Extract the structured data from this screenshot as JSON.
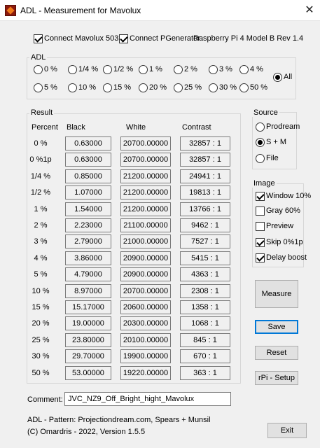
{
  "window": {
    "title": "ADL - Measurement for Mavolux"
  },
  "connections": {
    "mavolux": {
      "label": "Connect Mavolux 5032",
      "checked": true
    },
    "pgenerator": {
      "label": "Connect PGenerator",
      "checked": true
    },
    "device_info": "Raspberry Pi 4 Model B Rev 1.4"
  },
  "adl": {
    "title": "ADL",
    "row1": [
      "0 %",
      "1/4 %",
      "1/2 %",
      "1 %",
      "2 %",
      "3 %",
      "4 %"
    ],
    "row2": [
      "5 %",
      "10 %",
      "15 %",
      "20 %",
      "25 %",
      "30 %",
      "50 %"
    ],
    "all_label": "All",
    "selected": "All"
  },
  "result": {
    "title": "Result",
    "headers": {
      "percent": "Percent",
      "black": "Black",
      "white": "White",
      "contrast": "Contrast"
    },
    "rows": [
      {
        "percent": "0 %",
        "black": "0.63000",
        "white": "20700.00000",
        "contrast": "32857 : 1"
      },
      {
        "percent": "0 %1p",
        "black": "0.63000",
        "white": "20700.00000",
        "contrast": "32857 : 1"
      },
      {
        "percent": "1/4 %",
        "black": "0.85000",
        "white": "21200.00000",
        "contrast": "24941 : 1"
      },
      {
        "percent": "1/2 %",
        "black": "1.07000",
        "white": "21200.00000",
        "contrast": "19813 : 1"
      },
      {
        "percent": "1 %",
        "black": "1.54000",
        "white": "21200.00000",
        "contrast": "13766 : 1"
      },
      {
        "percent": "2 %",
        "black": "2.23000",
        "white": "21100.00000",
        "contrast": "9462 : 1"
      },
      {
        "percent": "3 %",
        "black": "2.79000",
        "white": "21000.00000",
        "contrast": "7527 : 1"
      },
      {
        "percent": "4 %",
        "black": "3.86000",
        "white": "20900.00000",
        "contrast": "5415 : 1"
      },
      {
        "percent": "5 %",
        "black": "4.79000",
        "white": "20900.00000",
        "contrast": "4363 : 1"
      },
      {
        "percent": "10 %",
        "black": "8.97000",
        "white": "20700.00000",
        "contrast": "2308 : 1"
      },
      {
        "percent": "15 %",
        "black": "15.17000",
        "white": "20600.00000",
        "contrast": "1358 : 1"
      },
      {
        "percent": "20 %",
        "black": "19.00000",
        "white": "20300.00000",
        "contrast": "1068 : 1"
      },
      {
        "percent": "25 %",
        "black": "23.80000",
        "white": "20100.00000",
        "contrast": "845 : 1"
      },
      {
        "percent": "30 %",
        "black": "29.70000",
        "white": "19900.00000",
        "contrast": "670 : 1"
      },
      {
        "percent": "50 %",
        "black": "53.00000",
        "white": "19220.00000",
        "contrast": "363 : 1"
      }
    ]
  },
  "source": {
    "title": "Source",
    "options": [
      "Prodream",
      "S + M",
      "File"
    ],
    "selected": "S + M"
  },
  "image": {
    "title": "Image",
    "options": [
      {
        "label": "Window 10%",
        "checked": true
      },
      {
        "label": "Gray 60%",
        "checked": false
      },
      {
        "label": "Preview",
        "checked": false
      },
      {
        "label": "Skip 0%1p",
        "checked": true
      },
      {
        "label": "Delay boost",
        "checked": true
      }
    ]
  },
  "buttons": {
    "measure": "Measure",
    "save": "Save",
    "reset": "Reset",
    "rpi_setup": "rPi - Setup",
    "exit": "Exit"
  },
  "comment": {
    "label": "Comment:",
    "value": "JVC_NZ9_Off_Bright_hight_Mavolux"
  },
  "footer": {
    "line1": "ADL - Pattern: Projectiondream.com, Spears + Munsil",
    "line2": "(C) Omardris - 2022, Version 1.5.5"
  },
  "icons": {
    "app": "app-icon",
    "close": "close-icon"
  }
}
